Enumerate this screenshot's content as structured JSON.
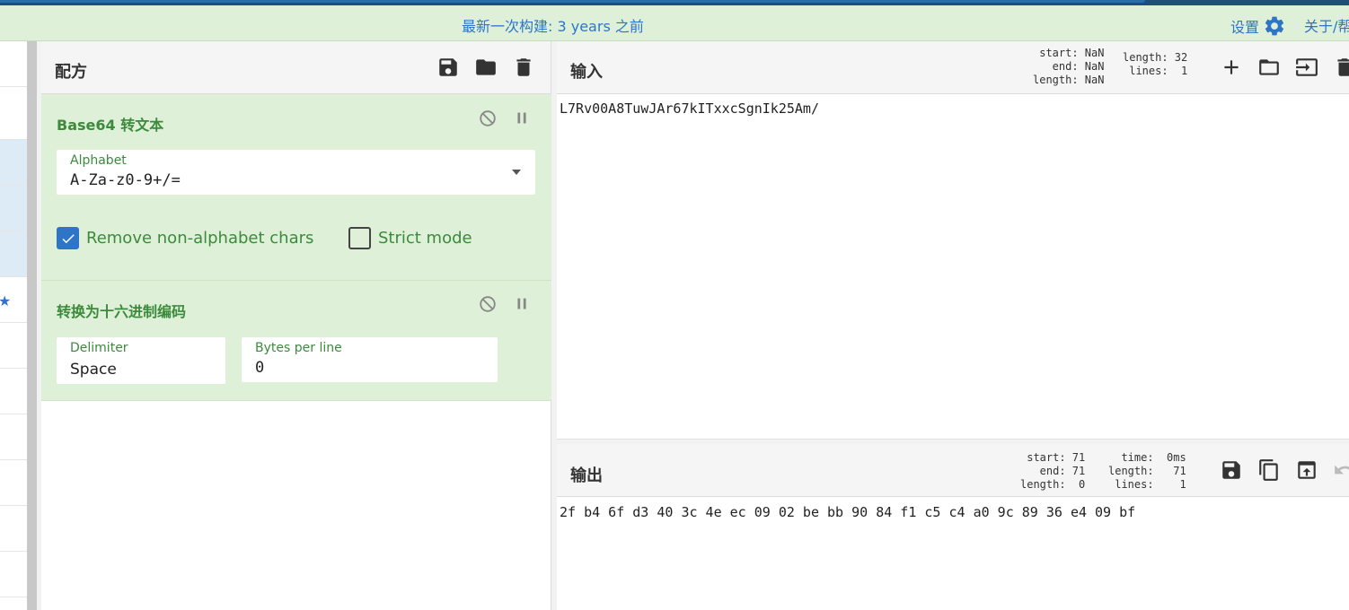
{
  "banner": {
    "build_text": "最新一次构建: 3 years 之前",
    "settings_label": "设置",
    "about_label": "关于/帮"
  },
  "recipe": {
    "title": "配方",
    "icons": [
      "save-icon",
      "folder-icon",
      "trash-icon"
    ],
    "operations": [
      {
        "title": "Base64 转文本",
        "alphabet_label": "Alphabet",
        "alphabet_value": "A-Za-z0-9+/=",
        "options": [
          {
            "label": "Remove non-alphabet chars",
            "checked": true
          },
          {
            "label": "Strict mode",
            "checked": false
          }
        ]
      },
      {
        "title": "转换为十六进制编码",
        "delimiter_label": "Delimiter",
        "delimiter_value": "Space",
        "bytes_label": "Bytes per line",
        "bytes_value": "0"
      }
    ]
  },
  "input": {
    "title": "输入",
    "stats_left": "start: NaN\n  end: NaN\nlength: NaN",
    "stats_right": "length: 32\n lines:  1",
    "text": "L7Rv00A8TuwJAr67kITxxcSgnIk25Am/"
  },
  "output": {
    "title": "输出",
    "stats_left": "start: 71\n  end: 71\nlength:  0",
    "stats_right": "  time:  0ms\nlength:   71\n lines:    1",
    "text": "2f b4 6f d3 40 3c 4e ec 09 02 be bb 90 84 f1 c5 c4 a0 9c 89 36 e4 09 bf"
  },
  "colors": {
    "accent": "#2e75c8",
    "op_background": "#dff0d8",
    "op_text": "#3c8a3c"
  }
}
